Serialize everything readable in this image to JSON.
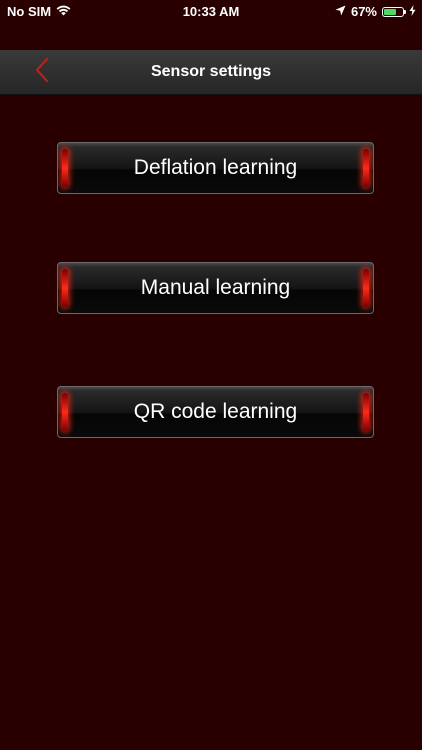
{
  "status_bar": {
    "carrier": "No SIM",
    "time": "10:33 AM",
    "battery_percent": "67%",
    "battery_level": 0.67,
    "battery_color": "#4cd964"
  },
  "nav": {
    "title": "Sensor settings",
    "back_icon": "chevron-left-icon",
    "accent_color": "#c81e1e"
  },
  "menu": {
    "items": [
      {
        "label": "Deflation learning"
      },
      {
        "label": "Manual learning"
      },
      {
        "label": "QR code learning"
      }
    ]
  },
  "colors": {
    "background": "#2a0000",
    "button_glow": "#ff2a1a"
  }
}
